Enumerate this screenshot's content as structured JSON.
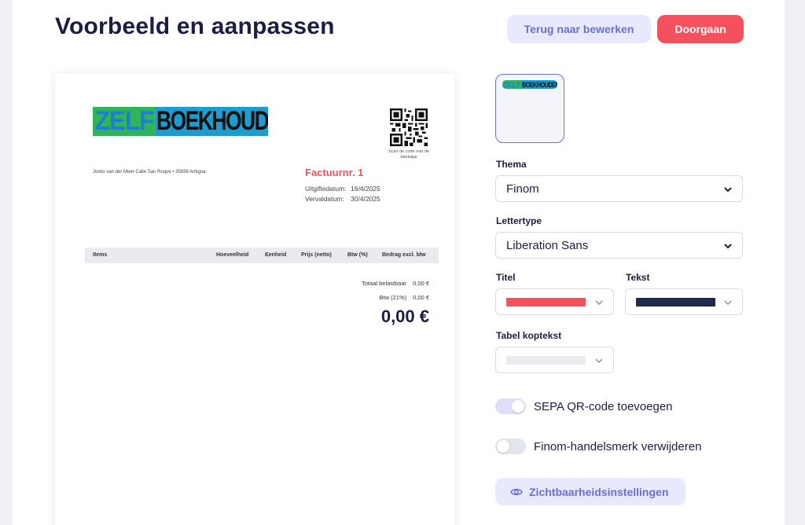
{
  "header": {
    "title": "Voorbeeld en aanpassen",
    "back_label": "Terug naar bewerken",
    "continue_label": "Doorgaan"
  },
  "invoice": {
    "logo_part1": "ZELF",
    "logo_part2": "BOEKHOUDEN",
    "qr_caption": "Scan de code met de bankapp",
    "sender_line": "Jovko van der Meer    Calle San Roque •  35638 Antigua",
    "title": "Factuurnr. 1",
    "date_label": "Uitgiftedatum:",
    "date_value": "16/4/2025",
    "due_label": "Vervaldatum:",
    "due_value": "30/4/2025",
    "columns": [
      "Items",
      "Hoeveelheid",
      "Eenheid",
      "Prijs (netto)",
      "Btw (%)",
      "Bedrag excl. btw"
    ],
    "totals": [
      {
        "label": "Totaal belastbaar",
        "value": "0,00 €"
      },
      {
        "label": "Btw (21%)",
        "value": "0,00 €"
      }
    ],
    "grand_total": "0,00 €"
  },
  "panel": {
    "theme_label": "Thema",
    "theme_value": "Finom",
    "font_label": "Lettertype",
    "font_value": "Liberation Sans",
    "title_color_label": "Titel",
    "title_color": "#f4505e",
    "text_color_label": "Tekst",
    "text_color": "#1e2a4d",
    "table_header_label": "Tabel koptekst",
    "table_header_color": "#e9ebee",
    "toggle_qr_label": "SEPA QR-code toevoegen",
    "toggle_qr_on": true,
    "toggle_brand_label": "Finom-handelsmerk verwijderen",
    "toggle_brand_on": false,
    "visibility_label": "Zichtbaarheidsinstellingen"
  },
  "colors": {
    "accent": "#6a6fd6",
    "primary_button": "#f4505e"
  }
}
